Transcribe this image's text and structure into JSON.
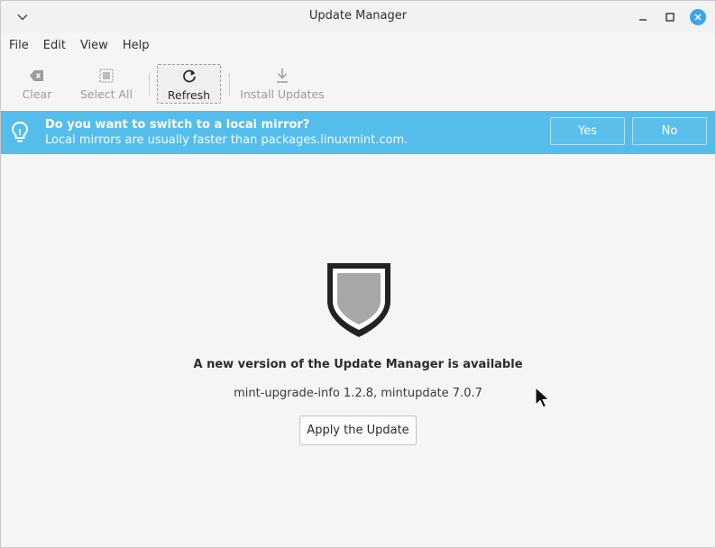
{
  "window": {
    "title": "Update Manager"
  },
  "menu": {
    "items": [
      "File",
      "Edit",
      "View",
      "Help"
    ]
  },
  "toolbar": {
    "clear_label": "Clear",
    "select_all_label": "Select All",
    "refresh_label": "Refresh",
    "install_label": "Install Updates"
  },
  "infobar": {
    "title": "Do you want to switch to a local mirror?",
    "subtitle": "Local mirrors are usually faster than packages.linuxmint.com.",
    "yes_label": "Yes",
    "no_label": "No",
    "icon": "lightbulb-icon",
    "color": "#55bdec"
  },
  "main": {
    "icon": "shield-icon",
    "headline": "A new version of the Update Manager is available",
    "versions": "mint-upgrade-info 1.2.8, mintupdate 7.0.7",
    "apply_label": "Apply the Update"
  },
  "colors": {
    "close_button": "#3aa5ea",
    "background": "#f5f5f5"
  }
}
